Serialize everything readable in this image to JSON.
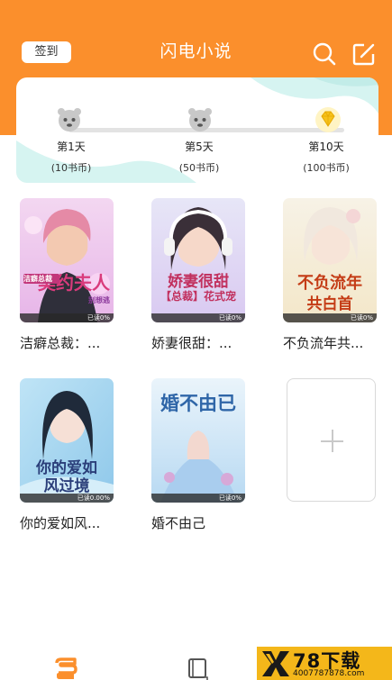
{
  "header": {
    "checkin_label": "签到",
    "title": "闪电小说"
  },
  "signin": {
    "days": [
      {
        "label": "第1天",
        "reward": "(10书币)",
        "icon": "mascot-face-icon"
      },
      {
        "label": "第5天",
        "reward": "(50书币)",
        "icon": "mascot-face-icon"
      },
      {
        "label": "第10天",
        "reward": "(100书币)",
        "icon": "diamond-icon"
      }
    ]
  },
  "books": [
    {
      "name": "洁癖总裁：...",
      "cover_title": "契约夫人",
      "cover_sub": "洁癖总裁",
      "cover_sub2": "别想逃",
      "progress": "已读0%"
    },
    {
      "name": "娇妻很甜：...",
      "cover_title": "娇妻很甜",
      "cover_sub": "【总裁】花式宠",
      "progress": "已读0%"
    },
    {
      "name": "不负流年共...",
      "cover_title": "不负流年",
      "cover_sub": "共白首",
      "progress": "已读0%"
    },
    {
      "name": "你的爱如风...",
      "cover_title": "你的爱如",
      "cover_sub": "风过境",
      "progress": "已读0.00%"
    },
    {
      "name": "婚不由己",
      "cover_title": "婚不由已",
      "progress": "已读0%"
    }
  ],
  "tabbar": {
    "items": [
      {
        "icon": "bookshelf-stack-icon",
        "active": true
      },
      {
        "icon": "book-icon",
        "active": false
      }
    ]
  },
  "watermark": {
    "brand": "78下载",
    "url": "4007787878.com"
  },
  "colors": {
    "accent": "#fb8f2c",
    "watermark": "#f4b71a"
  }
}
